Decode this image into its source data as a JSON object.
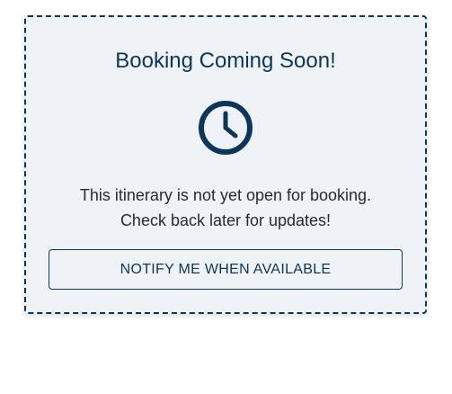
{
  "card": {
    "title": "Booking Coming Soon!",
    "icon": "clock-icon",
    "message_line1": "This itinerary is not yet open for booking.",
    "message_line2": "Check back later for updates!",
    "button_label": "NOTIFY ME WHEN AVAILABLE"
  },
  "colors": {
    "primary": "#0c3558",
    "card_background": "#eff2f7",
    "text": "#2a2a2a"
  }
}
